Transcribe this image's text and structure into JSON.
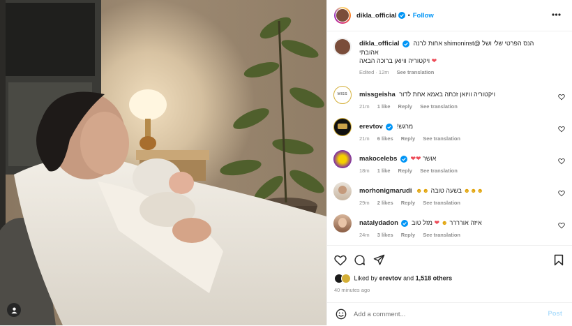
{
  "post": {
    "username": "dikla_official",
    "follow_label": "Follow",
    "more_icon": "more-options-icon",
    "caption_line1": "הנס הפרטי שלי ושל @shimoninst אחות לרנה",
    "caption_line2": "אהובתי",
    "caption_line3": "ויקטוריה וויואן ברוכה הבאה",
    "caption_meta_time": "Edited · 12m",
    "see_translation": "See translation"
  },
  "comments": [
    {
      "user": "missgeisha",
      "text": "ויקטוריה וויואן זכתה באמא אחת לדור",
      "time": "21m",
      "likes": "1 like",
      "reply": "Reply",
      "translate": "See translation",
      "verified": false
    },
    {
      "user": "erevtov",
      "text": "מרגש!",
      "time": "21m",
      "likes": "6 likes",
      "reply": "Reply",
      "translate": "See translation",
      "verified": true
    },
    {
      "user": "makocelebs",
      "text": "אושר",
      "time": "18m",
      "likes": "1 like",
      "reply": "Reply",
      "translate": "See translation",
      "verified": true
    },
    {
      "user": "morhonigmarudi",
      "text": "בשעה טובה",
      "time": "29m",
      "likes": "2 likes",
      "reply": "Reply",
      "translate": "See translation",
      "verified": false
    },
    {
      "user": "natalydadon",
      "text": "איזה אורררר",
      "text2": "מזל טוב",
      "time": "24m",
      "likes": "3 likes",
      "reply": "Reply",
      "translate": "See translation",
      "verified": true
    }
  ],
  "likes": {
    "prefix": "Liked by",
    "user": "erevtov",
    "and": "and",
    "count": "1,518 others"
  },
  "time_ago": "40 minutes ago",
  "add_comment": {
    "placeholder": "Add a comment...",
    "post_label": "Post"
  },
  "colors": {
    "accent": "#0095f6",
    "verified": "#0095f6",
    "heart": "#ed4956"
  }
}
